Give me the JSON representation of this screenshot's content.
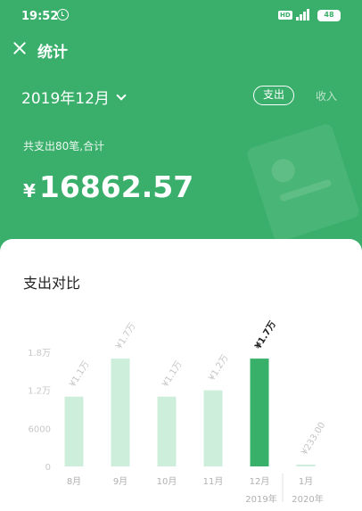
{
  "status_bar": {
    "time": "19:52",
    "network": "HD",
    "battery": "48"
  },
  "header": {
    "title": "统计"
  },
  "period": {
    "label": "2019年12月"
  },
  "tabs": {
    "expense": "支出",
    "income": "收入"
  },
  "summary": {
    "text": "共支出80笔,合计",
    "currency": "¥",
    "amount": "16862.57"
  },
  "card": {
    "title": "支出对比"
  },
  "colors": {
    "brand": "#3aaf6b",
    "bar_light": "#cdeedb",
    "bar_active": "#39b06a"
  },
  "chart_data": {
    "type": "bar",
    "categories": [
      "8月",
      "9月",
      "10月",
      "11月",
      "12月",
      "1月"
    ],
    "values": [
      11000,
      17000,
      11000,
      12000,
      17000,
      233
    ],
    "data_labels": [
      "¥1.1万",
      "¥1.7万",
      "¥1.1万",
      "¥1.2万",
      "¥1.7万",
      "¥233.00"
    ],
    "active_index": 4,
    "y_ticks": [
      0,
      6000,
      12000,
      18000
    ],
    "y_tick_labels": [
      "0",
      "6000",
      "1.2万",
      "1.8万"
    ],
    "ylim": [
      0,
      18000
    ],
    "year_labels": [
      "2019年",
      "2020年"
    ],
    "year_label_indices": [
      4,
      5
    ],
    "grid": false,
    "legend": "none"
  }
}
